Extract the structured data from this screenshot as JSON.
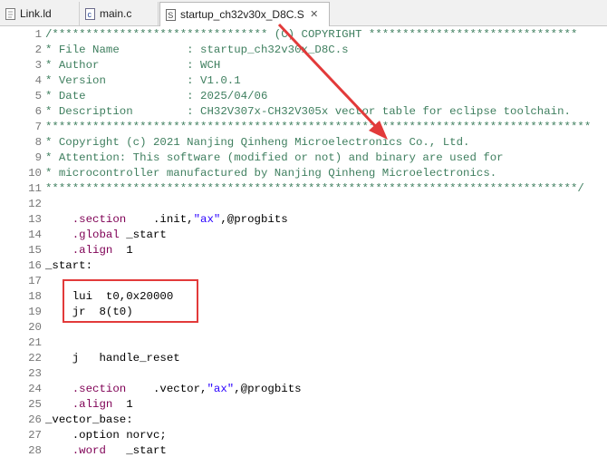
{
  "tabs": [
    {
      "label": "Link.ld",
      "icon": "linker-file-icon"
    },
    {
      "label": "main.c",
      "icon": "c-source-file-icon"
    },
    {
      "label": "startup_ch32v30x_D8C.S",
      "icon": "assembly-file-icon",
      "active": true,
      "close": "✕"
    }
  ],
  "lines": [
    {
      "n": "1",
      "t": "/******************************** (C) COPYRIGHT *******************************"
    },
    {
      "n": "2",
      "t": "* File Name          : startup_ch32v30x_D8C.s"
    },
    {
      "n": "3",
      "t": "* Author             : WCH"
    },
    {
      "n": "4",
      "t": "* Version            : V1.0.1"
    },
    {
      "n": "5",
      "t": "* Date               : 2025/04/06"
    },
    {
      "n": "6",
      "t": "* Description        : CH32V307x-CH32V305x vector table for eclipse toolchain."
    },
    {
      "n": "7",
      "t": "*********************************************************************************"
    },
    {
      "n": "8",
      "t": "* Copyright (c) 2021 Nanjing Qinheng Microelectronics Co., Ltd."
    },
    {
      "n": "9",
      "t": "* Attention: This software (modified or not) and binary are used for"
    },
    {
      "n": "10",
      "t": "* microcontroller manufactured by Nanjing Qinheng Microelectronics."
    },
    {
      "n": "11",
      "t": "*******************************************************************************/"
    },
    {
      "n": "12",
      "t": ""
    },
    {
      "n": "13",
      "kw": ".section",
      "pre": "    ",
      "mid": "    .init,",
      "str": "\"ax\"",
      "post": ",@progbits"
    },
    {
      "n": "14",
      "kw": ".global",
      "pre": "    ",
      "mid": " _start"
    },
    {
      "n": "15",
      "kw": ".align",
      "pre": "    ",
      "mid": "  1"
    },
    {
      "n": "16",
      "t": "_start:",
      "asm": true
    },
    {
      "n": "17",
      "t": ""
    },
    {
      "n": "18",
      "t": "    lui  t0,0x20000",
      "asm": true
    },
    {
      "n": "19",
      "t": "    jr  8(t0)",
      "asm": true
    },
    {
      "n": "20",
      "t": ""
    },
    {
      "n": "21",
      "t": ""
    },
    {
      "n": "22",
      "t": "    j   handle_reset",
      "asm": true
    },
    {
      "n": "23",
      "t": ""
    },
    {
      "n": "24",
      "kw": ".section",
      "pre": "    ",
      "mid": "    .vector,",
      "str": "\"ax\"",
      "post": ",@progbits"
    },
    {
      "n": "25",
      "kw": ".align",
      "pre": "    ",
      "mid": "  1"
    },
    {
      "n": "26",
      "t": "_vector_base:",
      "asm": true
    },
    {
      "n": "27",
      "t": "    .option norvc;",
      "asm": true
    },
    {
      "n": "28",
      "kw": ".word",
      "pre": "    ",
      "mid": "   _start"
    }
  ],
  "annotation_color": "#e23a3a"
}
